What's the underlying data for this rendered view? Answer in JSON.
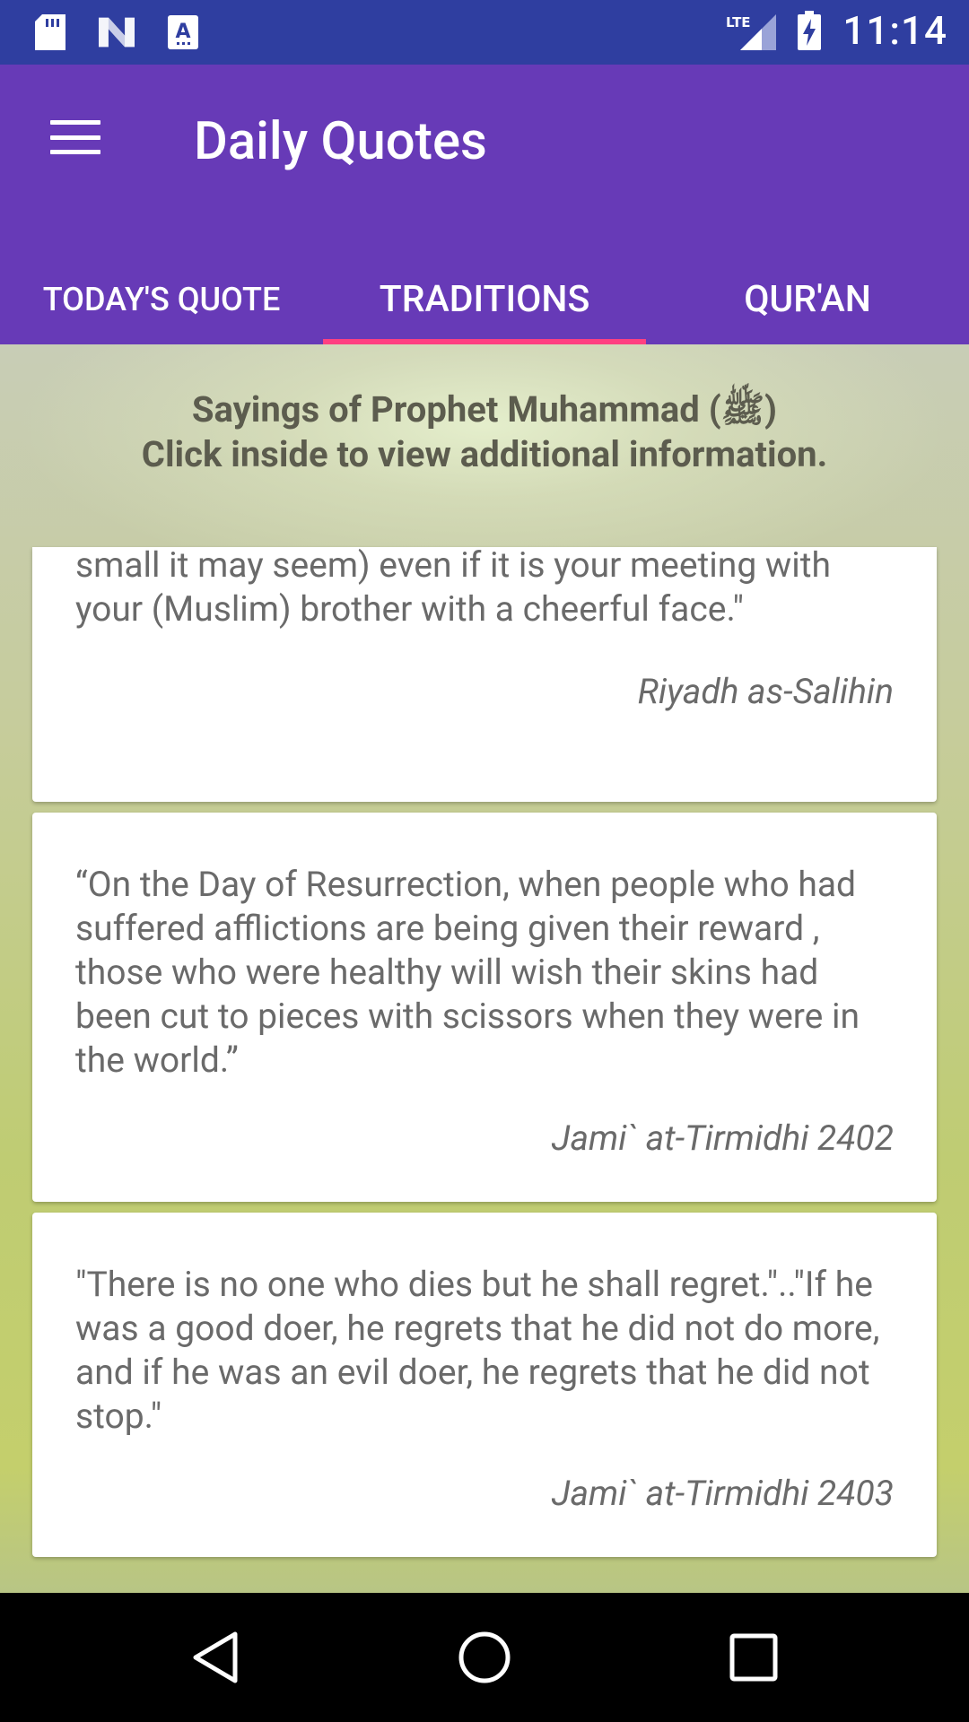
{
  "status_bar": {
    "time": "11:14",
    "network": "LTE",
    "left_icons": [
      "sd-card-icon",
      "n-logo-icon",
      "font-a-icon"
    ],
    "right_icons": [
      "lte-signal-icon",
      "battery-charging-icon"
    ]
  },
  "app_bar": {
    "title": "Daily Quotes",
    "menu_icon": "hamburger-menu-icon",
    "color": "#673ab7"
  },
  "tabs": [
    {
      "label": "TODAY'S QUOTE",
      "selected": false
    },
    {
      "label": "TRADITIONS",
      "selected": true
    },
    {
      "label": "QUR'AN",
      "selected": false
    }
  ],
  "tab_indicator_color": "#ff4081",
  "header": {
    "line1": "Sayings of Prophet Muhammad (ﷺ)",
    "line2": "Click inside to view additional information."
  },
  "cards": [
    {
      "quote": "small it may seem) even if it is your meeting with your (Muslim) brother with a cheerful face.\"",
      "source": "Riyadh as-Salihin"
    },
    {
      "quote": " “On the Day of Resurrection, when people who had suffered afflictions are being given their reward , those who were healthy will wish their skins had been cut to pieces with scissors when they were in the world.”",
      "source": "Jami` at-Tirmidhi 2402"
    },
    {
      "quote": "\"There is no one who dies but he shall regret.\"..\"If he was a good doer, he regrets that he did not do more, and if he was an evil doer, he regrets that he did not stop.\"",
      "source": "Jami` at-Tirmidhi 2403"
    }
  ],
  "nav_bar": {
    "buttons": [
      "back-icon",
      "home-icon",
      "recents-icon"
    ]
  }
}
